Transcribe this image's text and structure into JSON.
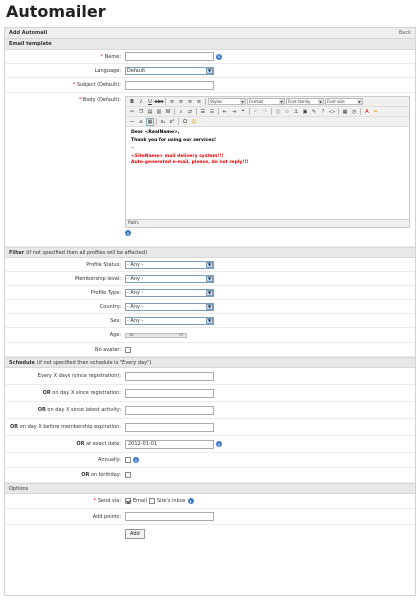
{
  "page_title": "Automailer",
  "panel": {
    "title": "Add Automail",
    "back": "Back"
  },
  "email_template": {
    "section": "Email template",
    "name_label": "Name:",
    "language_label": "Language:",
    "language_value": "Default",
    "subject_label": "Subject (Default):",
    "body_label": "Body (Default):",
    "toolbar": {
      "styles": "Styles",
      "format": "Format",
      "font_family": "Font family",
      "font_size": "Font size"
    },
    "body": {
      "greeting": "Dear <RealName>,",
      "thanks": "Thank you for using our services!",
      "dashes": "--",
      "line1": "<SiteName> mail delivery system!!!",
      "line2": "Auto-generated e-mail, please, do not reply!!!"
    },
    "path_label": "Path:"
  },
  "filter": {
    "section_bold": "Filter",
    "section_rest": "(if not specified then all profiles will be affected)",
    "rows": [
      {
        "label": "Profile Status:",
        "value": "- Any -"
      },
      {
        "label": "Membership level:",
        "value": "- Any -"
      },
      {
        "label": "Profile Type:",
        "value": "- Any -"
      },
      {
        "label": "Country:",
        "value": "- Any -"
      },
      {
        "label": "Sex:",
        "value": "- Any -"
      }
    ],
    "age_label": "Age:",
    "age_min": "18",
    "age_max": "75",
    "no_avatar_label": "No avatar:"
  },
  "schedule": {
    "section_bold": "Schedule",
    "section_rest": "(if not specified then schedule is \"Every day\")",
    "every_x_label": "Every X days (since registration):",
    "or": "OR",
    "on_day_registration": "on day X since registration:",
    "on_day_activity": "on day X since latest activity:",
    "on_day_expiration": "on day X before membership expiration:",
    "exact_date_label": "at exact date:",
    "exact_date_value": "2012-01-01",
    "annually_label": "Annually:",
    "birthday_label": "on birthday:"
  },
  "options": {
    "section": "Options",
    "send_via_label": "Send via:",
    "email_label": "Email",
    "site_inbox_label": "Site's inbox",
    "add_points_label": "Add points:",
    "add_button": "Add"
  }
}
